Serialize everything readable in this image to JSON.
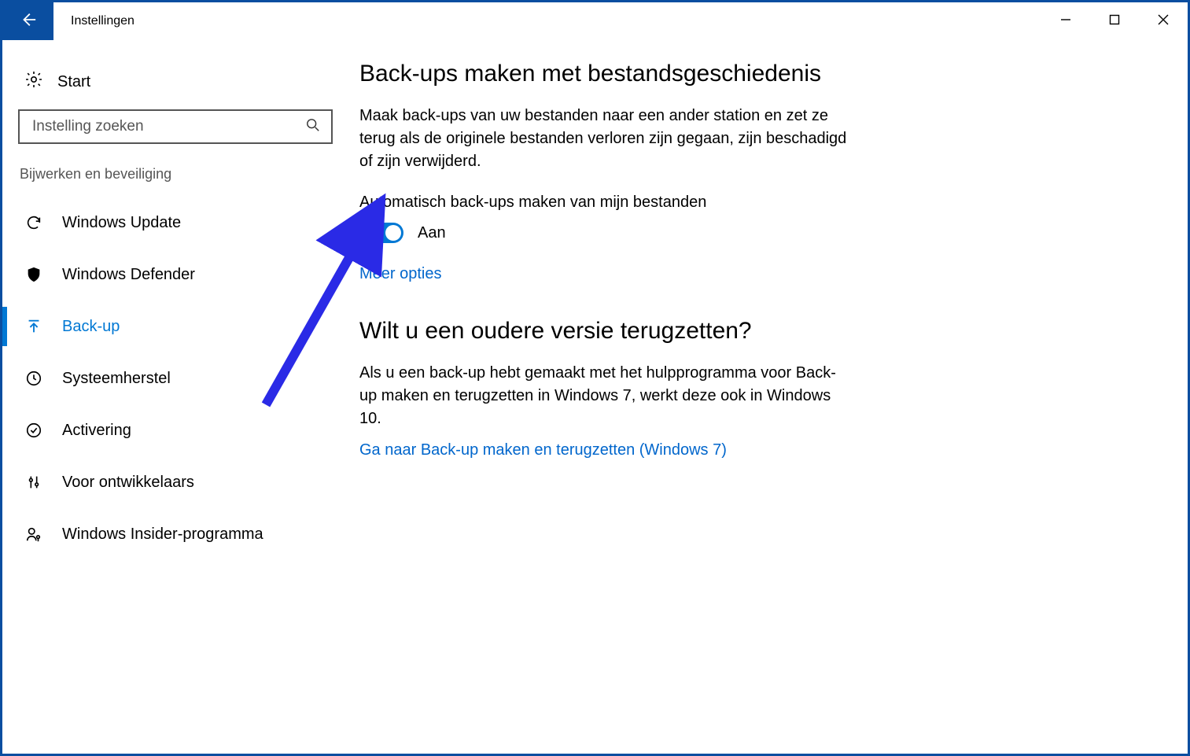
{
  "titlebar": {
    "title": "Instellingen"
  },
  "sidebar": {
    "start_label": "Start",
    "search_placeholder": "Instelling zoeken",
    "category_label": "Bijwerken en beveiliging",
    "items": [
      {
        "label": "Windows Update"
      },
      {
        "label": "Windows Defender"
      },
      {
        "label": "Back-up"
      },
      {
        "label": "Systeemherstel"
      },
      {
        "label": "Activering"
      },
      {
        "label": "Voor ontwikkelaars"
      },
      {
        "label": "Windows Insider-programma"
      }
    ]
  },
  "main": {
    "heading1": "Back-ups maken met bestandsgeschiedenis",
    "paragraph1": "Maak back-ups van uw bestanden naar een ander station en zet ze terug als de originele bestanden verloren zijn gegaan, zijn beschadigd of zijn verwijderd.",
    "toggle_label": "Automatisch back-ups maken van mijn bestanden",
    "toggle_state": "Aan",
    "more_options": "Meer opties",
    "heading2": "Wilt u een oudere versie terugzetten?",
    "paragraph2": "Als u een back-up hebt gemaakt met het hulpprogramma voor Back-up maken en terugzetten in Windows 7, werkt deze ook in Windows 10.",
    "link2": "Ga naar Back-up maken en terugzetten (Windows 7)"
  }
}
